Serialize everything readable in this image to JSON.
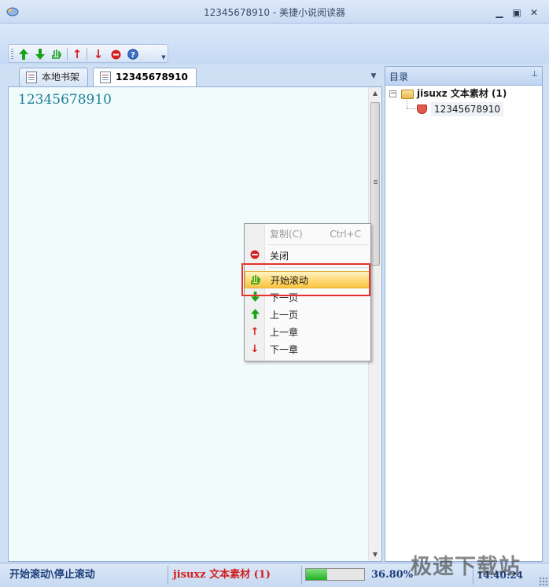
{
  "window": {
    "title": "12345678910 - 美捷小说阅读器",
    "controls": [
      "minimize",
      "maximize",
      "close"
    ]
  },
  "toolbar": {
    "buttons": [
      {
        "name": "up-green-arrow-icon",
        "glyph": "🡅",
        "color": "#1aa11a"
      },
      {
        "name": "down-green-arrow-icon",
        "glyph": "🡇",
        "color": "#1aa11a"
      },
      {
        "name": "scroll-hand-icon",
        "glyph": "✋",
        "color": "#1aa11a"
      },
      {
        "name": "up-red-arrow-icon",
        "glyph": "↑",
        "color": "#d42020"
      },
      {
        "name": "down-red-arrow-icon",
        "glyph": "↓",
        "color": "#d42020"
      },
      {
        "name": "close-red-icon",
        "glyph": "⊖",
        "color": "#d42020"
      },
      {
        "name": "help-icon",
        "glyph": "?",
        "color": "#2a5db5"
      }
    ]
  },
  "tabs": [
    {
      "label": "本地书架",
      "active": false
    },
    {
      "label": "12345678910",
      "active": true
    }
  ],
  "document": {
    "text": "12345678910"
  },
  "context_menu": {
    "items": [
      {
        "label": "复制(C)",
        "shortcut": "Ctrl+C",
        "disabled": true
      },
      {
        "label": "关闭",
        "icon": "close-red-icon"
      },
      {
        "label": "开始滚动",
        "icon": "scroll-hand-icon",
        "highlighted": true
      },
      {
        "label": "下一页",
        "icon": "down-green-arrow-icon"
      },
      {
        "label": "上一页",
        "icon": "up-green-arrow-icon"
      },
      {
        "label": "上一章",
        "icon": "up-red-arrow-icon"
      },
      {
        "label": "下一章",
        "icon": "down-red-arrow-icon"
      }
    ]
  },
  "toc": {
    "title": "目录",
    "pin": "⊥",
    "root": {
      "label": "jisuxz 文本素材 (1)",
      "expander": "−"
    },
    "child": {
      "label": "12345678910"
    }
  },
  "statusbar": {
    "left": "开始滚动\\停止滚动",
    "book": "jisuxz 文本素材 (1)",
    "progress_percent": 36.8,
    "progress_label": "36.80%",
    "time": "14:40:24"
  },
  "watermark": "极速下载站",
  "colors": {
    "doc_text": "#1d7f96",
    "status_book": "#d21f1f",
    "status_left": "#1f3f7a",
    "status_percent": "#1f3f7a",
    "highlight": "#ffd66b",
    "annotation_box": "#e8312f"
  }
}
